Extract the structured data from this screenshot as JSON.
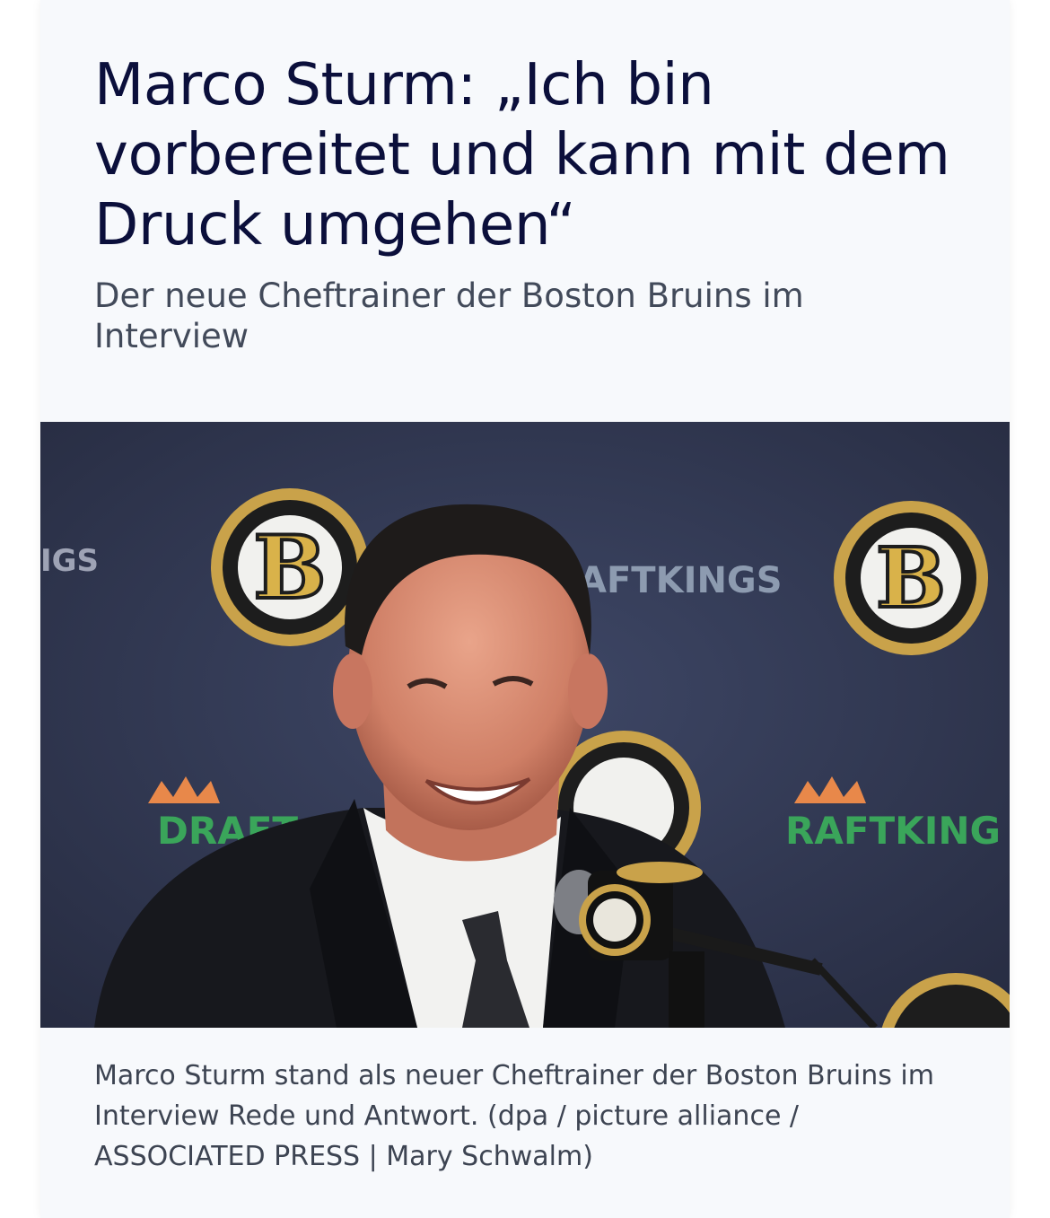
{
  "article": {
    "headline": "Marco Sturm: „Ich bin vorbereitet und kann mit dem Druck umgehen“",
    "subline": "Der neue Cheftrainer der Boston Bruins im Interview",
    "image": {
      "description_icon": "photo-press-conference",
      "backdrop_logo_letter": "B",
      "sponsor_text_left": "IGS",
      "sponsor_text_mid": "AFTKINGS",
      "sponsor_text_right": "RAFTKING",
      "sponsor_text_lower_left": "DRAFT"
    },
    "caption": "Marco Sturm stand als neuer Cheftrainer der Boston Bruins im Interview Rede und Antwort. (dpa / picture alliance / ASSOCIATED PRESS | Mary Schwalm)"
  },
  "colors": {
    "headline": "#0b0f3b",
    "subline": "#424a5a",
    "card_background": "#f7f9fc",
    "bruins_gold": "#c9a24a",
    "backdrop": "#2f3650"
  }
}
